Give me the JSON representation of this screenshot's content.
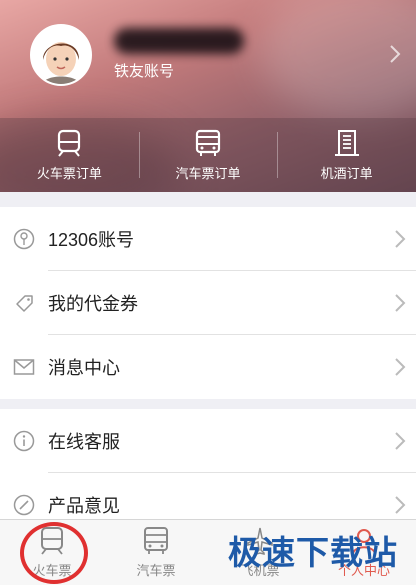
{
  "profile": {
    "account_type_label": "铁友账号"
  },
  "orders": [
    {
      "label": "火车票订单",
      "icon": "train-icon"
    },
    {
      "label": "汽车票订单",
      "icon": "bus-icon"
    },
    {
      "label": "机酒订单",
      "icon": "hotel-icon"
    }
  ],
  "menu_group1": [
    {
      "label": "12306账号",
      "icon": "tree-icon"
    },
    {
      "label": "我的代金券",
      "icon": "coupon-icon"
    },
    {
      "label": "消息中心",
      "icon": "mail-icon"
    }
  ],
  "menu_group2": [
    {
      "label": "在线客服",
      "icon": "info-icon"
    },
    {
      "label": "产品意见",
      "icon": "pen-icon"
    }
  ],
  "tabbar": [
    {
      "label": "火车票",
      "icon": "train-icon",
      "active": false
    },
    {
      "label": "汽车票",
      "icon": "bus-icon",
      "active": false
    },
    {
      "label": "飞机票",
      "icon": "plane-icon",
      "active": false
    },
    {
      "label": "个人中心",
      "icon": "person-icon",
      "active": true
    }
  ],
  "watermark": "极速下载站",
  "colors": {
    "accent": "#e05a4e",
    "annotation_circle": "#e03030",
    "watermark": "#1e5aa8"
  }
}
